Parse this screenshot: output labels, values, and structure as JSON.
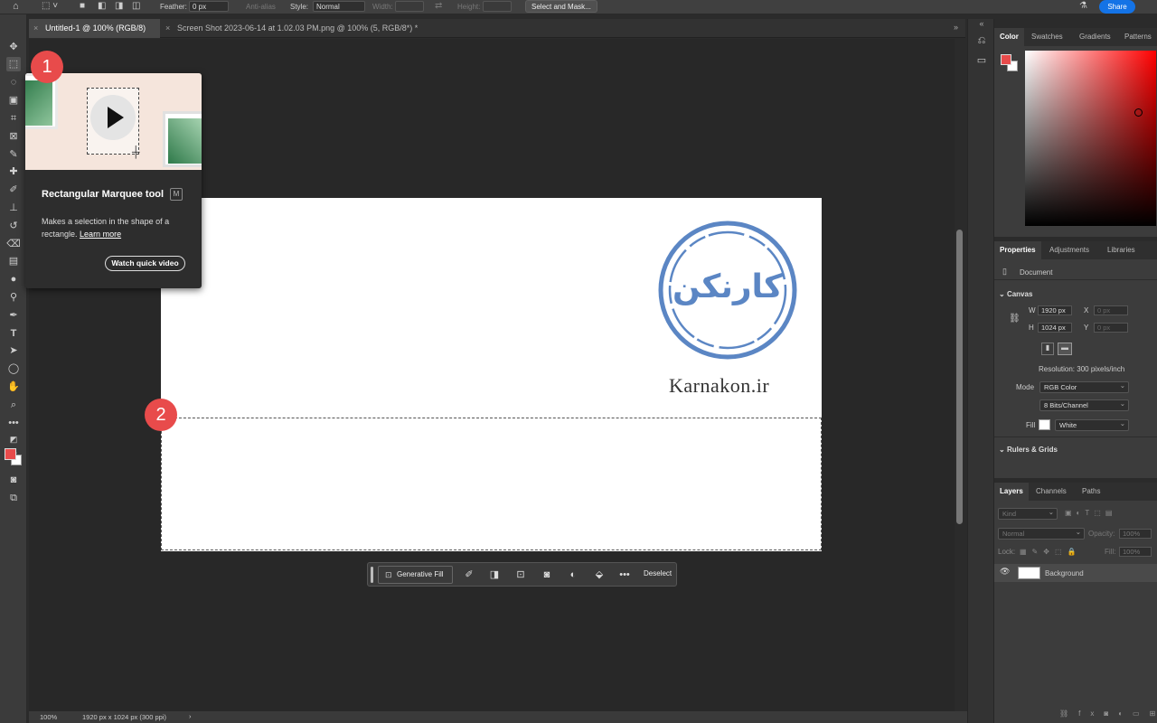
{
  "options_bar": {
    "feather_label": "Feather:",
    "feather_value": "0 px",
    "anti_alias_label": "Anti-alias",
    "style_label": "Style:",
    "style_value": "Normal",
    "width_label": "Width:",
    "height_label": "Height:",
    "select_mask_label": "Select and Mask...",
    "share_label": "Share"
  },
  "tabs": [
    {
      "label": "Untitled-1 @ 100% (RGB/8)",
      "active": true
    },
    {
      "label": "Screen Shot 2023-06-14 at 1.02.03 PM.png @ 100% (5, RGB/8*) *",
      "active": false
    }
  ],
  "toolbar": {
    "tools": [
      "move-tool",
      "rectangular-marquee-tool",
      "lasso-tool",
      "object-selection-tool",
      "crop-tool",
      "frame-tool",
      "eyedropper-tool",
      "spot-healing-tool",
      "brush-tool",
      "clone-stamp-tool",
      "history-brush-tool",
      "eraser-tool",
      "gradient-tool",
      "blur-tool",
      "dodge-tool",
      "pen-tool",
      "type-tool",
      "path-selection-tool",
      "ellipse-tool",
      "hand-tool",
      "zoom-tool",
      "more-tools"
    ],
    "foreground_color": "#e84b4b",
    "background_color": "#ffffff"
  },
  "tooltip": {
    "title": "Rectangular Marquee tool",
    "shortcut": "M",
    "description": "Makes a selection in the shape of a rectangle.",
    "learn_more": "Learn more",
    "button": "Watch quick video"
  },
  "badges": {
    "first": "1",
    "second": "2"
  },
  "canvas": {
    "logo_text": "کارنکن",
    "site_text": "Karnakon.ir"
  },
  "contextual_bar": {
    "generative_fill": "Generative Fill",
    "deselect": "Deselect"
  },
  "color_panel": {
    "tabs": [
      "Color",
      "Swatches",
      "Gradients",
      "Patterns"
    ]
  },
  "properties_panel": {
    "tabs": [
      "Properties",
      "Adjustments",
      "Libraries"
    ],
    "document_label": "Document",
    "canvas_section": "Canvas",
    "w_label": "W",
    "w_value": "1920 px",
    "h_label": "H",
    "h_value": "1024 px",
    "x_label": "X",
    "x_placeholder": "0 px",
    "y_label": "Y",
    "y_placeholder": "0 px",
    "resolution": "Resolution: 300 pixels/inch",
    "mode_label": "Mode",
    "mode_value": "RGB Color",
    "depth_value": "8 Bits/Channel",
    "fill_label": "Fill",
    "fill_value": "White",
    "rulers_section": "Rulers & Grids"
  },
  "layers_panel": {
    "tabs": [
      "Layers",
      "Channels",
      "Paths"
    ],
    "kind_placeholder": "Kind",
    "blend_mode": "Normal",
    "opacity_label": "Opacity:",
    "opacity_value": "100%",
    "lock_label": "Lock:",
    "fill_label": "Fill:",
    "fill_value": "100%",
    "layers": [
      {
        "name": "Background"
      }
    ]
  },
  "status_bar": {
    "zoom": "100%",
    "doc_info": "1920 px x 1024 px (300 ppi)"
  },
  "colors": {
    "accent": "#1473e6",
    "badge": "#e84b4b",
    "logo_blue": "#5b86c4"
  }
}
